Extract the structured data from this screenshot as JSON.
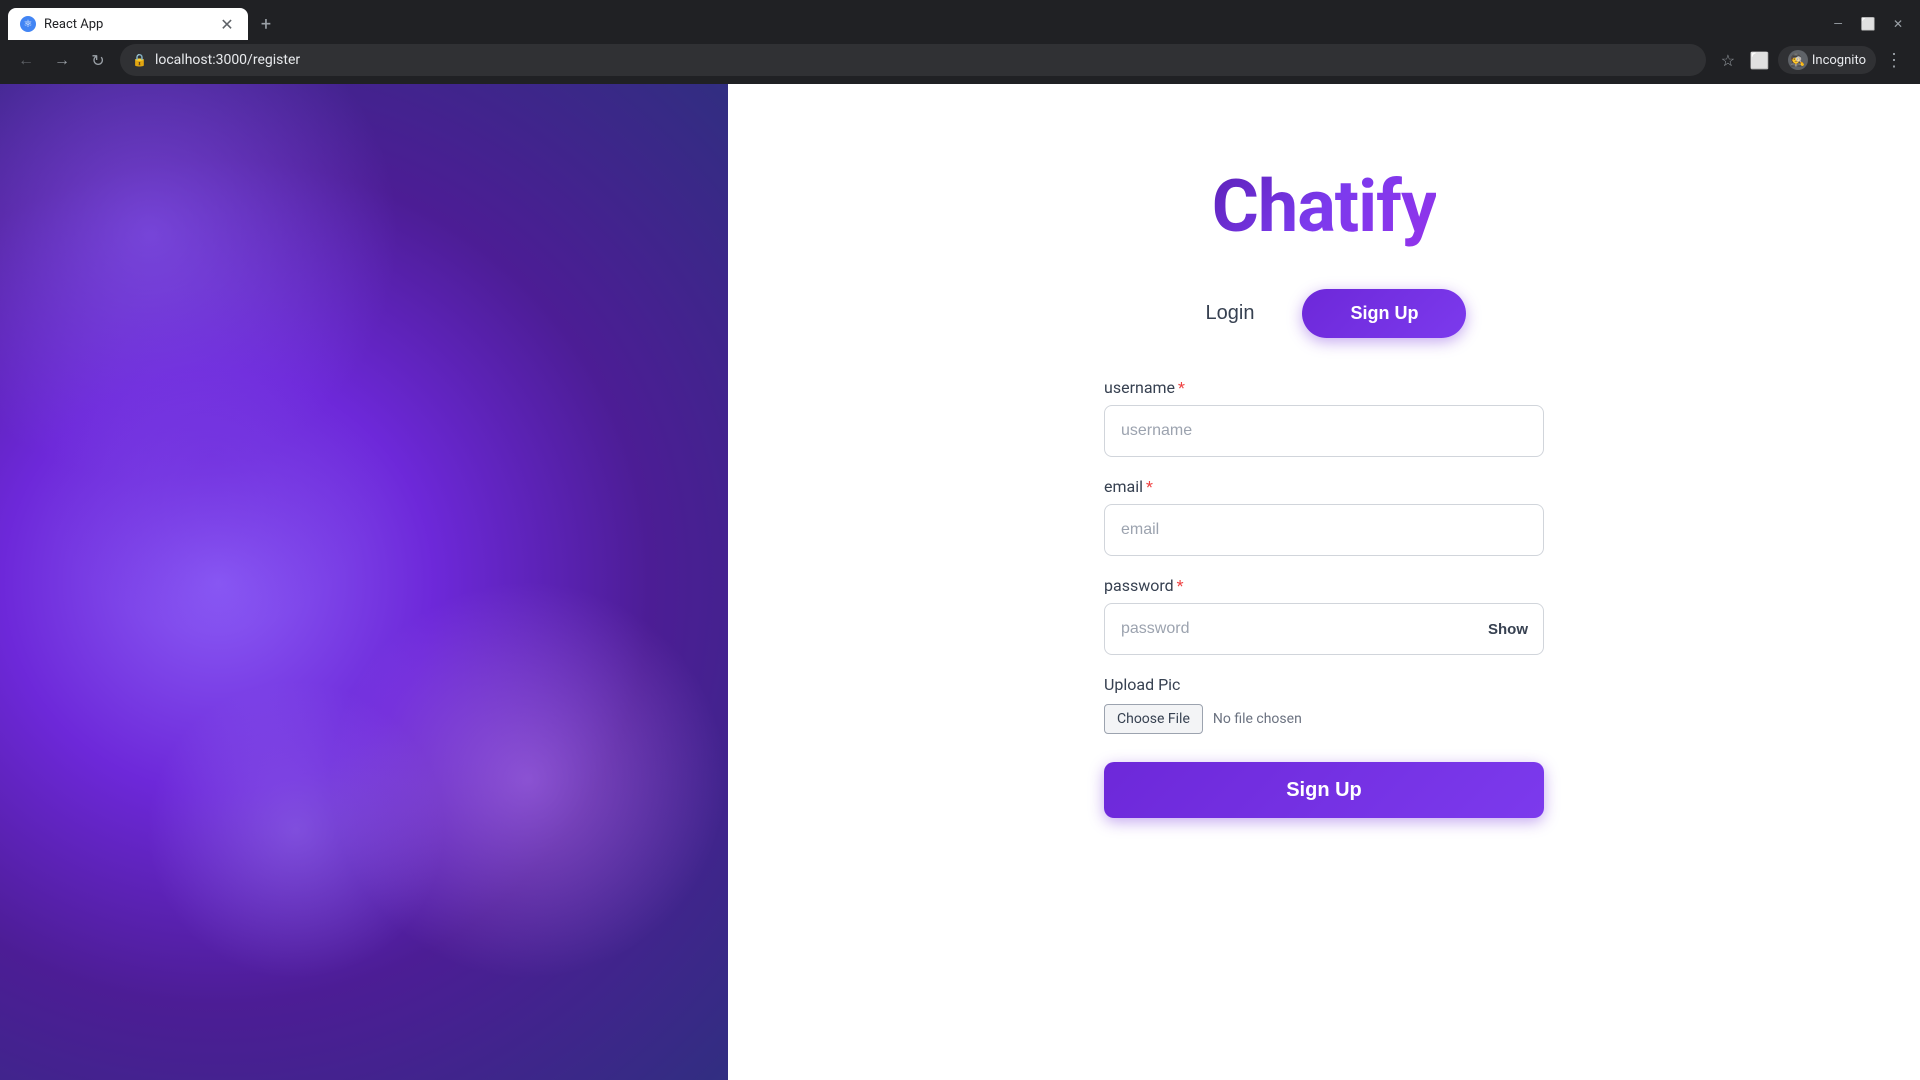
{
  "browser": {
    "tab_title": "React App",
    "url": "localhost:3000/register",
    "incognito_label": "Incognito"
  },
  "app": {
    "brand": "Chatify",
    "tabs": {
      "login": "Login",
      "signup": "Sign Up"
    },
    "form": {
      "username_label": "username",
      "username_placeholder": "username",
      "email_label": "email",
      "email_placeholder": "email",
      "password_label": "password",
      "password_placeholder": "password",
      "show_label": "Show",
      "upload_label": "Upload Pic",
      "choose_file_label": "Choose File",
      "no_file_text": "No file chosen",
      "submit_label": "Sign Up"
    }
  }
}
